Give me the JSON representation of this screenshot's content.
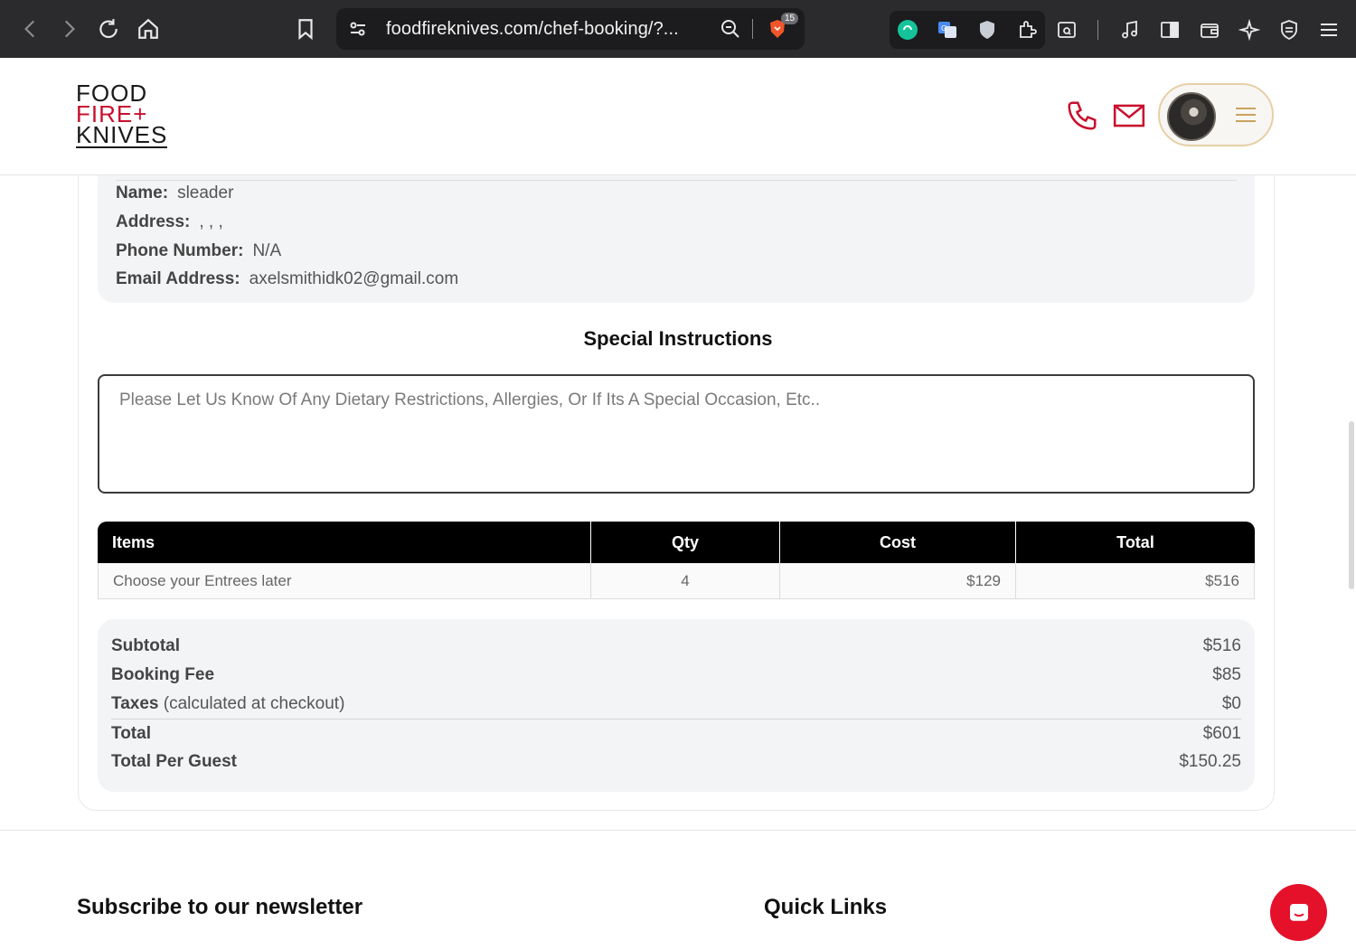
{
  "browser": {
    "url": "foodfireknives.com/chef-booking/?...",
    "shield_badge": "15"
  },
  "site": {
    "logo": {
      "line1": "FOOD",
      "line2": "FIRE+",
      "line3": "KNIVES"
    }
  },
  "customer": {
    "name_label": "Name:",
    "name": "sleader",
    "address_label": "Address:",
    "address": ", , ,",
    "phone_label": "Phone Number:",
    "phone": "N/A",
    "email_label": "Email Address:",
    "email": "axelsmithidk02@gmail.com"
  },
  "special_instructions": {
    "title": "Special Instructions",
    "placeholder": "Please Let Us Know Of Any Dietary Restrictions, Allergies, Or If Its A Special Occasion, Etc.."
  },
  "order_table": {
    "headers": {
      "items": "Items",
      "qty": "Qty",
      "cost": "Cost",
      "total": "Total"
    },
    "rows": [
      {
        "item": "Choose your Entrees later",
        "qty": "4",
        "cost": "$129",
        "total": "$516"
      }
    ]
  },
  "summary": {
    "subtotal_label": "Subtotal",
    "subtotal": "$516",
    "booking_fee_label": "Booking Fee",
    "booking_fee": "$85",
    "taxes_label": "Taxes",
    "taxes_note": "(calculated at checkout)",
    "taxes": "$0",
    "total_label": "Total",
    "total": "$601",
    "per_guest_label": "Total Per Guest",
    "per_guest": "$150.25"
  },
  "footer": {
    "newsletter_title": "Subscribe to our newsletter",
    "quick_links_title": "Quick Links"
  },
  "colors": {
    "brand_red": "#c8102e",
    "accent_gold": "#c9a35e",
    "chat_red": "#e5102a"
  }
}
